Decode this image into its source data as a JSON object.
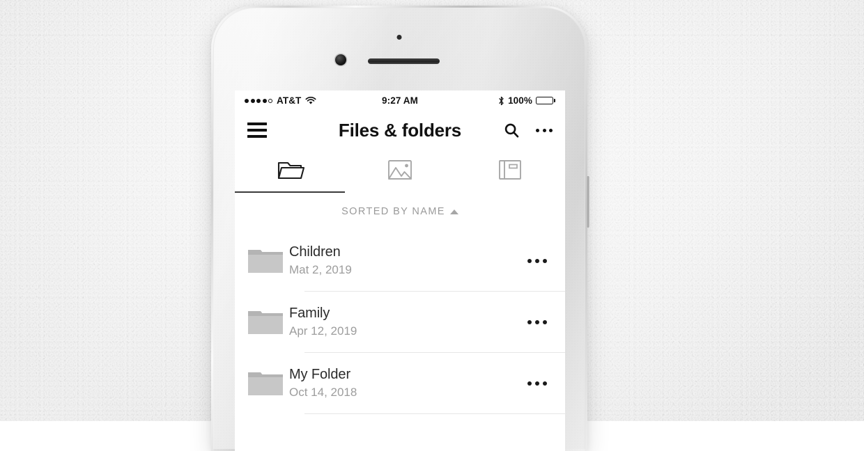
{
  "status_bar": {
    "signal_dots_filled": 4,
    "signal_dots_total": 5,
    "carrier": "AT&T",
    "wifi_icon": "wifi-icon",
    "time": "9:27 AM",
    "bluetooth_icon": "bluetooth-icon",
    "battery_percent": "100%",
    "battery_level": 100
  },
  "nav": {
    "menu_icon": "hamburger-menu-icon",
    "title": "Files & folders",
    "search_icon": "search-icon",
    "overflow_icon": "overflow-menu-icon"
  },
  "tabs": [
    {
      "name": "folders",
      "icon": "folder-icon",
      "active": true
    },
    {
      "name": "photos",
      "icon": "image-gallery-icon",
      "active": false
    },
    {
      "name": "albums",
      "icon": "album-book-icon",
      "active": false
    }
  ],
  "sort": {
    "label": "SORTED BY NAME",
    "direction": "ascending",
    "arrow_icon": "triangle-up-icon"
  },
  "list": {
    "items": [
      {
        "icon": "folder-filled-icon",
        "name": "Children",
        "date": "Mat 2, 2019",
        "more_icon": "overflow-menu-icon"
      },
      {
        "icon": "folder-filled-icon",
        "name": "Family",
        "date": "Apr 12, 2019",
        "more_icon": "overflow-menu-icon"
      },
      {
        "icon": "folder-filled-icon",
        "name": "My Folder",
        "date": "Oct 14, 2018",
        "more_icon": "overflow-menu-icon"
      }
    ]
  },
  "device": {
    "sensor_icon": "proximity-sensor",
    "camera_icon": "front-camera",
    "speaker_icon": "earpiece-speaker",
    "side_button_icon": "power-button"
  },
  "colors": {
    "screen_bg": "#ffffff",
    "text_primary": "#2b2b2b",
    "text_secondary": "#9d9d9d",
    "accent_underline": "#3a3a3a",
    "folder_fill": "#c4c4c4",
    "inactive_tab": "#a8a8a8",
    "divider": "#e6e6e6"
  }
}
